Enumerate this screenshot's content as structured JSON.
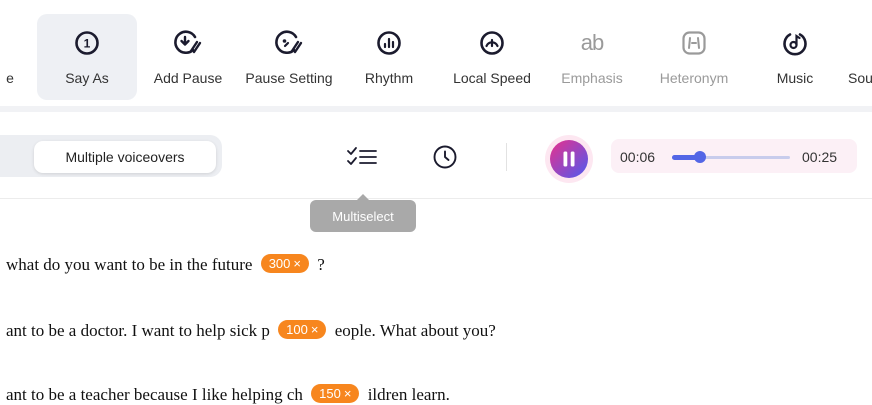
{
  "toolbar": {
    "items": [
      {
        "label": "e",
        "state": "partial",
        "icon": "none"
      },
      {
        "label": "Say As",
        "state": "active",
        "icon": "say-as-icon"
      },
      {
        "label": "Add Pause",
        "state": "normal",
        "icon": "add-pause-icon"
      },
      {
        "label": "Pause Setting",
        "state": "normal",
        "icon": "pause-setting-icon"
      },
      {
        "label": "Rhythm",
        "state": "normal",
        "icon": "rhythm-icon"
      },
      {
        "label": "Local Speed",
        "state": "normal",
        "icon": "local-speed-icon"
      },
      {
        "label": "Emphasis",
        "state": "disabled",
        "icon": "emphasis-icon"
      },
      {
        "label": "Heteronym",
        "state": "disabled",
        "icon": "heteronym-icon"
      },
      {
        "label": "Music",
        "state": "normal",
        "icon": "music-icon"
      },
      {
        "label": "Sou",
        "state": "partial",
        "icon": "none"
      }
    ],
    "say_as_glyph": "1",
    "emphasis_glyph": "ab",
    "heteronym_glyph": "[-|-]"
  },
  "controls": {
    "mode_label": "Multiple voiceovers",
    "multiselect_icon": "multiselect-icon",
    "history_icon": "clock-icon",
    "player": {
      "state": "playing",
      "current_time": "00:06",
      "total_time": "00:25",
      "progress": 0.24
    }
  },
  "tooltip": {
    "text": "Multiselect"
  },
  "content": {
    "lines": [
      {
        "before": "what do you want to be in the future",
        "badge": "300",
        "after": "?"
      },
      {
        "before": "ant to be a doctor. I want to help sick p",
        "badge": "100",
        "after": "eople. What about you?"
      },
      {
        "before": "ant to be a teacher because I like helping ch",
        "badge": "150",
        "after": "ildren learn."
      }
    ],
    "badge_close": "×"
  },
  "colors": {
    "accent": "#5366e6",
    "badge": "#f7861e",
    "play_gradient_start": "#e8308c",
    "play_gradient_end": "#4f5bf0"
  }
}
